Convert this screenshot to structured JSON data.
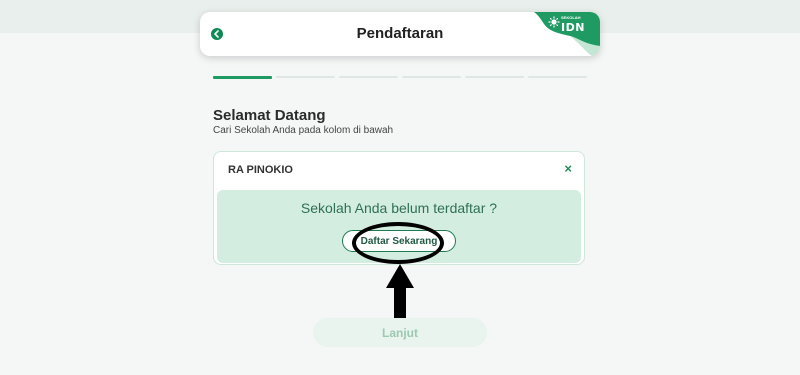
{
  "header": {
    "title": "Pendaftaran",
    "logo_text": "IDN",
    "logo_subtext": "SEKOLAH",
    "back_icon": "chevron-left-icon",
    "accent_color": "#0e8a55"
  },
  "progress": {
    "total_steps": 6,
    "current_step": 1
  },
  "welcome": {
    "title": "Selamat Datang",
    "subtitle": "Cari Sekolah Anda pada kolom di bawah"
  },
  "search": {
    "school_name": "RA PINOKIO",
    "clear_icon": "close-icon",
    "clear_symbol": "×"
  },
  "notice": {
    "message": "Sekolah Anda belum terdaftar ?",
    "button_label": "Daftar Sekarang"
  },
  "footer": {
    "next_label": "Lanjut"
  },
  "colors": {
    "brand_green": "#1f9a63",
    "notice_bg": "#d3eee0",
    "disabled_text": "#9cc9b1"
  }
}
